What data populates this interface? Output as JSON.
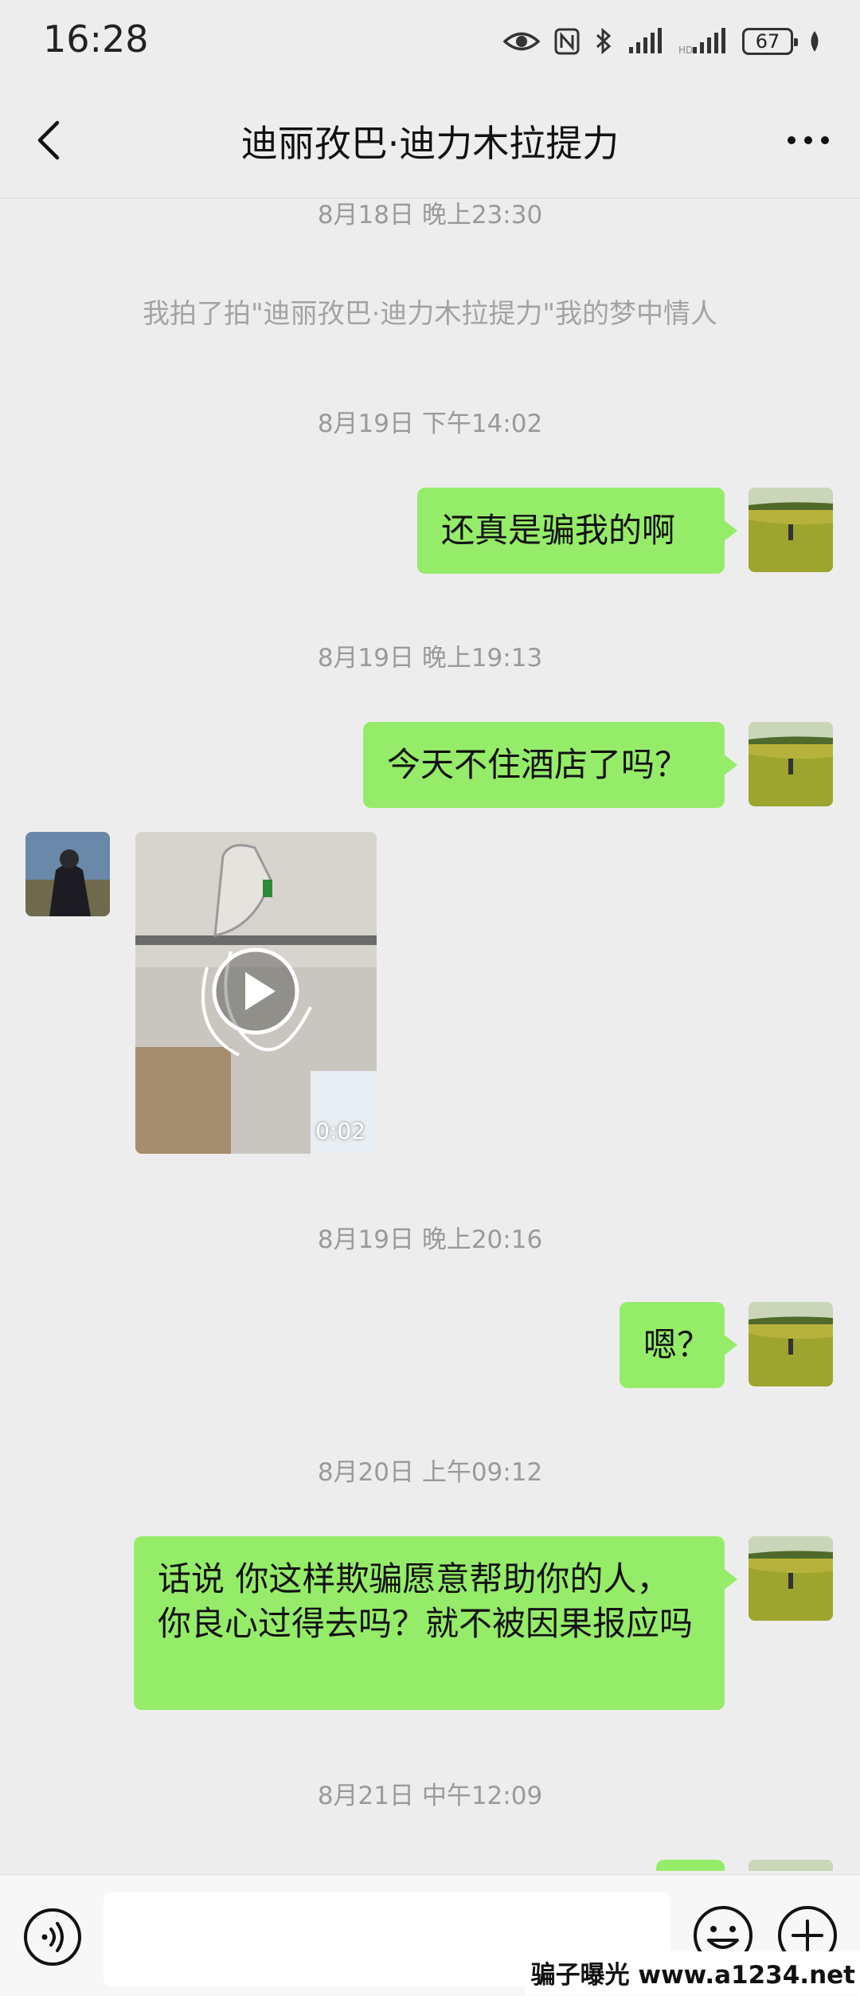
{
  "status": {
    "time": "16:28",
    "battery": "67"
  },
  "header": {
    "title": "迪丽孜巴·迪力木拉提力"
  },
  "messages": {
    "ts1": "8月18日 晚上23:30",
    "sys1": "我拍了拍\"迪丽孜巴·迪力木拉提力\"我的梦中情人",
    "ts2": "8月19日 下午14:02",
    "m1": "还真是骗我的啊",
    "ts3": "8月19日 晚上19:13",
    "m2": "今天不住酒店了吗？",
    "video_duration": "0:02",
    "ts4": "8月19日 晚上20:16",
    "m3": "嗯？",
    "ts5": "8月20日 上午09:12",
    "m4": "话说 你这样欺骗愿意帮助你的人，你良心过得去吗？就不被因果报应吗",
    "ts6": "8月21日 中午12:09"
  },
  "input": {
    "placeholder": ""
  },
  "watermark": "骗子曝光 www.a1234.net",
  "colors": {
    "bubble": "#95ec69",
    "background": "#ededed"
  }
}
